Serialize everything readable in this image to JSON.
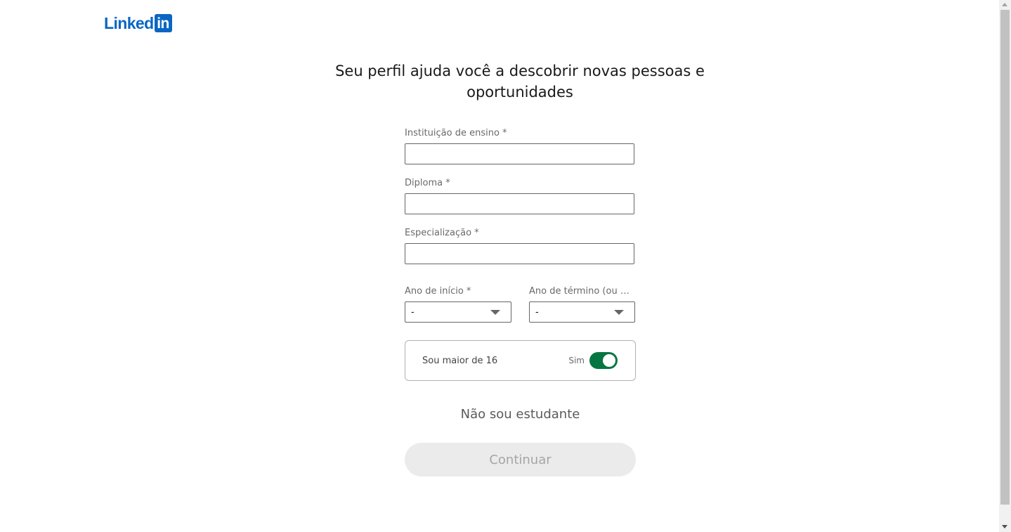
{
  "logo": {
    "text": "Linked",
    "box": "in",
    "color": "#0a66c2"
  },
  "headline": "Seu perfil ajuda você a descobrir novas pessoas e oportunidades",
  "fields": {
    "school": {
      "label": "Instituição de ensino *",
      "value": ""
    },
    "degree": {
      "label": "Diploma *",
      "value": ""
    },
    "specialization": {
      "label": "Especialização *",
      "value": ""
    },
    "start_year": {
      "label": "Ano de início *",
      "value": "-"
    },
    "end_year": {
      "label": "Ano de término (ou pr...",
      "value": "-"
    }
  },
  "age_toggle": {
    "label": "Sou maior de 16",
    "state": "Sim",
    "on": true,
    "color": "#057642"
  },
  "not_student_link": "Não sou estudante",
  "continue_button": {
    "label": "Continuar",
    "enabled": false
  },
  "icons": {
    "dropdown": "chevron-down-icon"
  }
}
